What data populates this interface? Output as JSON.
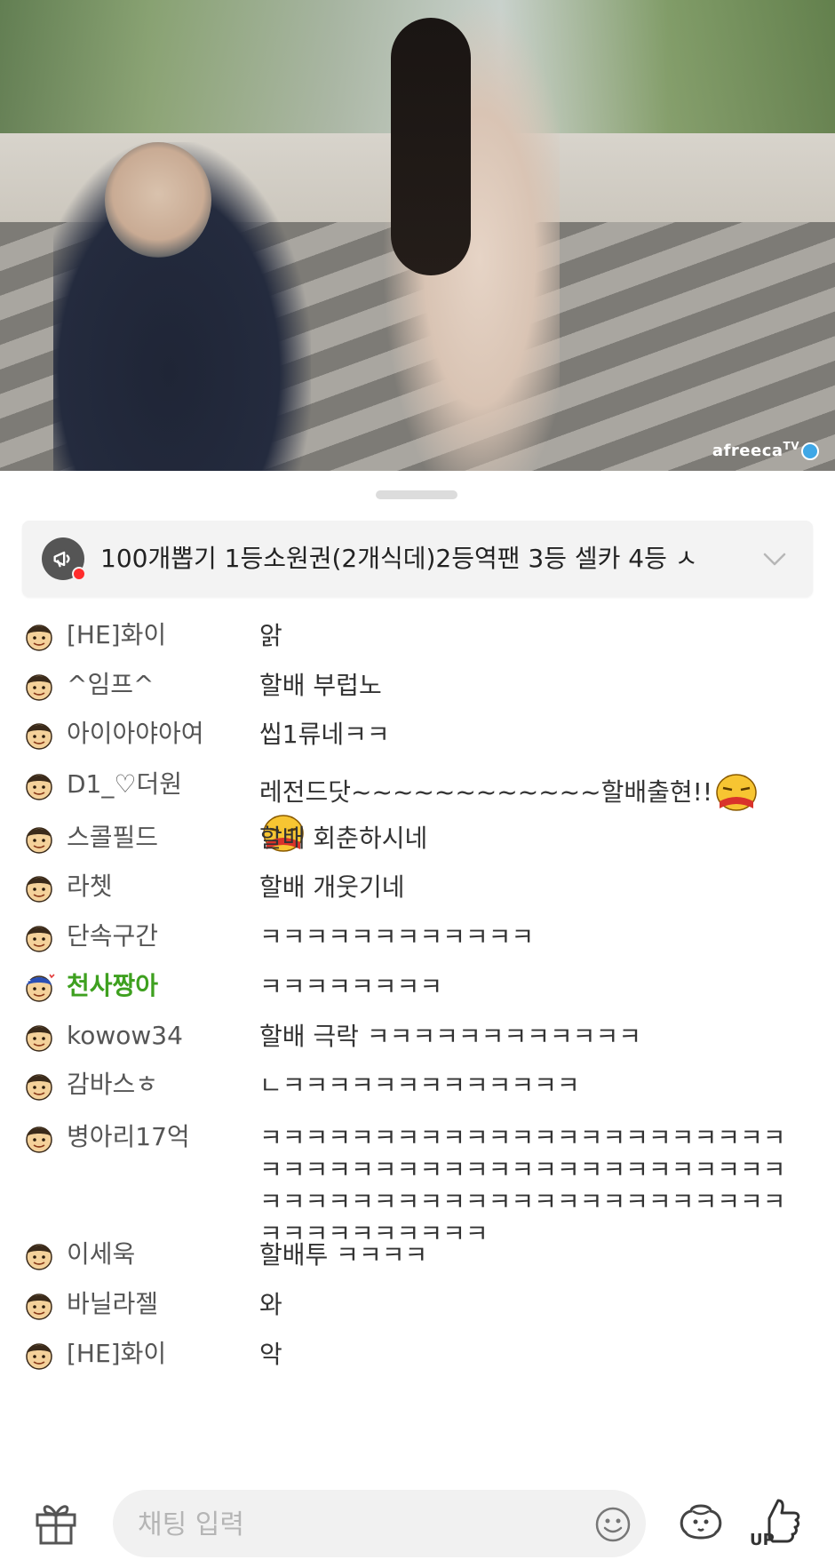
{
  "video": {
    "watermark": "afreeca",
    "watermark_suffix": "TV"
  },
  "notice": {
    "icon": "megaphone-icon",
    "text": "100개뽑기 1등소원권(2개식데)2등역팬 3등 셀카 4등 ㅅ",
    "expand_icon": "chevron-down-icon"
  },
  "chat": {
    "messages": [
      {
        "nick": "[HE]화이",
        "text": "앍",
        "fan": false
      },
      {
        "nick": "^임프^",
        "text": "할배 부럽노",
        "fan": false
      },
      {
        "nick": "아이아야아여",
        "text": "씹1류네ㅋㅋ",
        "fan": false
      },
      {
        "nick": "D1_♡더원",
        "text": "레전드닷~~~~~~~~~~~~할배출현!!",
        "fan": false,
        "emoticons": 2
      },
      {
        "nick": "스콜필드",
        "text": "할배 회춘하시네",
        "fan": false
      },
      {
        "nick": "라쳇",
        "text": "할배 개웃기네",
        "fan": false
      },
      {
        "nick": "단속구간",
        "text": "ㅋㅋㅋㅋㅋㅋㅋㅋㅋㅋㅋㅋ",
        "fan": false
      },
      {
        "nick": "천사짱아",
        "text": "ㅋㅋㅋㅋㅋㅋㅋㅋ",
        "fan": true
      },
      {
        "nick": "kowow34",
        "text": "할배 극락 ㅋㅋㅋㅋㅋㅋㅋㅋㅋㅋㅋㅋ",
        "fan": false
      },
      {
        "nick": "감바스ㅎ",
        "text": "ㄴㅋㅋㅋㅋㅋㅋㅋㅋㅋㅋㅋㅋㅋ",
        "fan": false
      },
      {
        "nick": "병아리17억",
        "text": "ㅋㅋㅋㅋㅋㅋㅋㅋㅋㅋㅋㅋㅋㅋㅋㅋㅋㅋㅋㅋㅋㅋㅋㅋㅋㅋㅋㅋㅋㅋㅋㅋㅋㅋㅋㅋㅋㅋㅋㅋㅋㅋㅋㅋㅋㅋㅋㅋㅋㅋㅋㅋㅋㅋㅋㅋㅋㅋㅋㅋㅋㅋㅋㅋㅋㅋㅋㅋㅋㅋㅋㅋㅋㅋㅋㅋㅋㅋㅋ",
        "fan": false
      },
      {
        "nick": "이세욱",
        "text": "할배투 ㅋㅋㅋㅋ",
        "fan": false
      },
      {
        "nick": "바닐라젤",
        "text": "와",
        "fan": false
      },
      {
        "nick": "[HE]화이",
        "text": "악",
        "fan": false
      }
    ]
  },
  "input": {
    "placeholder": "채팅 입력",
    "gift_icon": "gift-icon",
    "emoji_icon": "smile-icon",
    "sticker_icon": "sticker-icon",
    "up_icon": "thumbs-up-icon",
    "up_label": "UP"
  }
}
